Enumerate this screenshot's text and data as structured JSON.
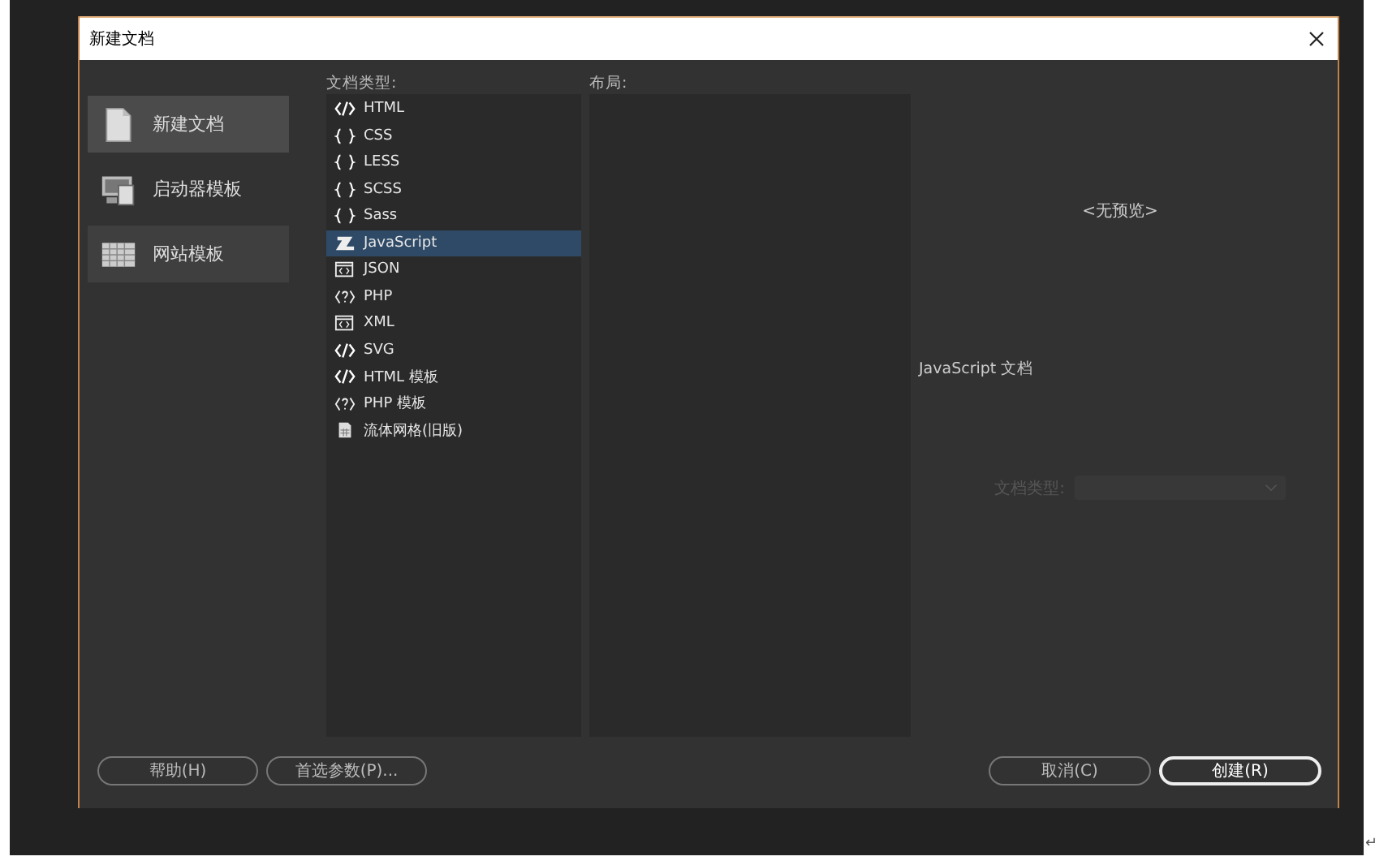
{
  "window": {
    "title": "新建文档"
  },
  "categories": [
    {
      "label": "新建文档",
      "kind": "page",
      "selected": true,
      "hovered": false
    },
    {
      "label": "启动器模板",
      "kind": "devices",
      "selected": false,
      "hovered": false
    },
    {
      "label": "网站模板",
      "kind": "grid",
      "selected": false,
      "hovered": true
    }
  ],
  "doc_types": {
    "label": "文档类型:",
    "items": [
      {
        "label": "HTML",
        "kind": "tag",
        "selected": false
      },
      {
        "label": "CSS",
        "kind": "braces",
        "selected": false
      },
      {
        "label": "LESS",
        "kind": "braces",
        "selected": false
      },
      {
        "label": "SCSS",
        "kind": "braces",
        "selected": false
      },
      {
        "label": "Sass",
        "kind": "braces",
        "selected": false
      },
      {
        "label": "JavaScript",
        "kind": "script",
        "selected": true
      },
      {
        "label": "JSON",
        "kind": "window",
        "selected": false
      },
      {
        "label": "PHP",
        "kind": "php",
        "selected": false
      },
      {
        "label": "XML",
        "kind": "window",
        "selected": false
      },
      {
        "label": "SVG",
        "kind": "tag",
        "selected": false
      },
      {
        "label": "HTML 模板",
        "kind": "tag",
        "selected": false
      },
      {
        "label": "PHP 模板",
        "kind": "php",
        "selected": false
      },
      {
        "label": "流体网格(旧版)",
        "kind": "gridpage",
        "selected": false
      }
    ]
  },
  "layout": {
    "label": "布局:"
  },
  "preview": {
    "text": "<无预览>",
    "description": "JavaScript 文档",
    "doctype_label": "文档类型:",
    "doctype_disabled": true
  },
  "buttons": [
    {
      "label": "帮助(H)",
      "kind": "normal"
    },
    {
      "label": "首选参数(P)...",
      "kind": "normal"
    },
    {
      "label": "取消(C)",
      "kind": "normal"
    },
    {
      "label": "创建(R)",
      "kind": "primary"
    }
  ],
  "return_mark": "↵"
}
